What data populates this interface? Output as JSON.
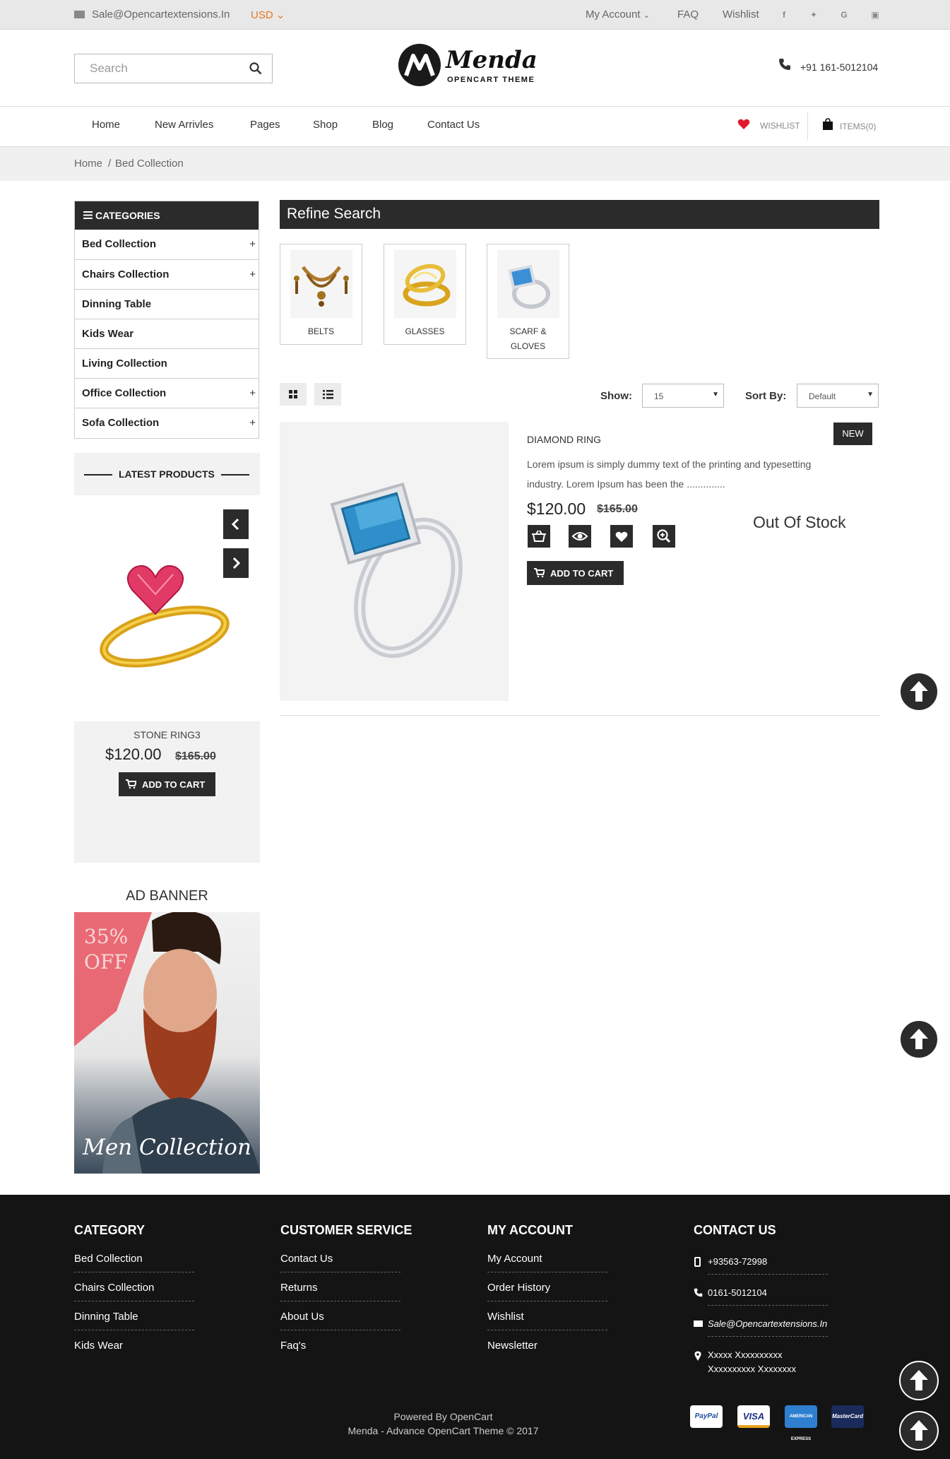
{
  "topbar": {
    "email": "Sale@Opencartextensions.In",
    "currency": "USD",
    "my_account": "My Account",
    "faq": "FAQ",
    "wishlist": "Wishlist",
    "social_icons": [
      "facebook-icon",
      "twitter-icon",
      "google-icon",
      "instagram-icon"
    ]
  },
  "header": {
    "search_placeholder": "Search",
    "logo_name": "Menda",
    "logo_tagline": "OPENCART THEME",
    "phone": "+91 161-5012104"
  },
  "nav": {
    "items": [
      "Home",
      "New Arrivles",
      "Pages",
      "Shop",
      "Blog",
      "Contact Us"
    ],
    "wishlist_label": "WISHLIST",
    "cart_label": "ITEMS(0)"
  },
  "breadcrumb": {
    "home": "Home",
    "sep": "/",
    "current": "Bed Collection"
  },
  "categories": {
    "title": "CATEGORIES",
    "items": [
      {
        "label": "Bed Collection",
        "expand": "+"
      },
      {
        "label": "Chairs Collection",
        "expand": "+"
      },
      {
        "label": "Dinning Table",
        "expand": ""
      },
      {
        "label": "Kids Wear",
        "expand": ""
      },
      {
        "label": "Living Collection",
        "expand": ""
      },
      {
        "label": "Office Collection",
        "expand": "+"
      },
      {
        "label": "Sofa Collection",
        "expand": "+"
      }
    ]
  },
  "latest": {
    "title": "LATEST PRODUCTS",
    "product_name": "STONE RING3",
    "price": "$120.00",
    "old_price": "$165.00",
    "add_to_cart": "ADD TO CART"
  },
  "ad_banner": {
    "title": "AD BANNER",
    "discount_line1": "35%",
    "discount_line2": "OFF",
    "caption": "Men Collection"
  },
  "refine": {
    "title": "Refine Search",
    "subcategories": [
      {
        "label": "BELTS"
      },
      {
        "label": "GLASSES"
      },
      {
        "label": "SCARF &"
      },
      {
        "label": "GLOVES"
      }
    ]
  },
  "toolbar": {
    "show_label": "Show:",
    "show_value": "15",
    "sort_label": "Sort By:",
    "sort_value": "Default"
  },
  "product": {
    "name": "DIAMOND RING",
    "badge": "NEW",
    "desc_line1": "Lorem ipsum is simply dummy text of the printing and typesetting",
    "desc_line2": "industry. Lorem Ipsum has been the ..............",
    "price": "$120.00",
    "old_price": "$165.00",
    "stock": "Out Of Stock",
    "add_to_cart": "ADD TO CART"
  },
  "footer": {
    "category": {
      "title": "CATEGORY",
      "links": [
        "Bed Collection",
        "Chairs Collection",
        "Dinning Table",
        "Kids Wear"
      ]
    },
    "service": {
      "title": "CUSTOMER SERVICE",
      "links": [
        "Contact Us",
        "Returns",
        "About Us",
        "Faq's"
      ]
    },
    "account": {
      "title": "MY ACCOUNT",
      "links": [
        "My Account",
        "Order History",
        "Wishlist",
        "Newsletter"
      ]
    },
    "contact": {
      "title": "CONTACT US",
      "mobile": "+93563-72998",
      "phone": "0161-5012104",
      "email": "Sale@Opencartextensions.In",
      "address_line1": "Xxxxx Xxxxxxxxxx",
      "address_line2": "Xxxxxxxxxx Xxxxxxxx"
    },
    "powered": "Powered By OpenCart",
    "copyright": "Menda - Advance OpenCart Theme © 2017",
    "payments": [
      "PayPal",
      "VISA",
      "AMERICAN EXPRESS",
      "MasterCard"
    ]
  },
  "colors": {
    "dark": "#2b2b2b",
    "footer": "#141414",
    "accent": "#e87722",
    "heart": "#e0182d"
  }
}
